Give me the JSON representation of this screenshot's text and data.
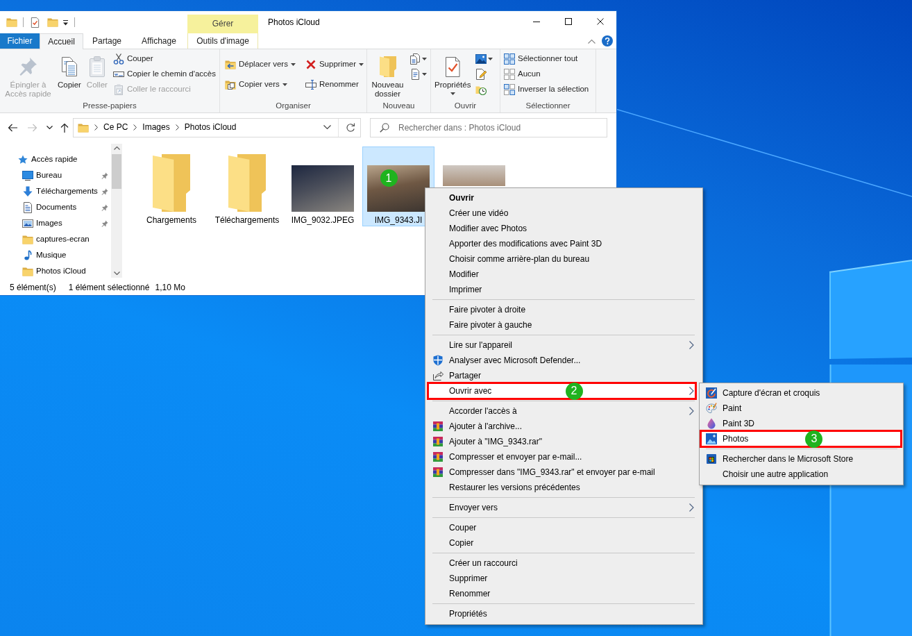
{
  "window": {
    "title": "Photos iCloud",
    "contextual_tab_group": "Gérer"
  },
  "tabs": [
    {
      "label": "Fichier",
      "kind": "file",
      "selected": false
    },
    {
      "label": "Accueil",
      "kind": "tab",
      "selected": true
    },
    {
      "label": "Partage",
      "kind": "tab",
      "selected": false
    },
    {
      "label": "Affichage",
      "kind": "tab",
      "selected": false
    },
    {
      "label": "Outils d'image",
      "kind": "contextual",
      "selected": false
    }
  ],
  "ribbon": {
    "groups": [
      {
        "label": "Presse-papiers",
        "buttons": [
          {
            "label": "Épingler à Accès rapide",
            "kind": "large",
            "disabled": true,
            "dropdown": false
          },
          {
            "label": "Copier",
            "kind": "large",
            "disabled": false,
            "dropdown": false
          },
          {
            "label": "Coller",
            "kind": "large",
            "disabled": true,
            "dropdown": false
          },
          {
            "label": "Couper",
            "kind": "small",
            "disabled": false,
            "dropdown": false
          },
          {
            "label": "Copier le chemin d'accès",
            "kind": "small",
            "disabled": false,
            "dropdown": false
          },
          {
            "label": "Coller le raccourci",
            "kind": "small",
            "disabled": true,
            "dropdown": false
          }
        ]
      },
      {
        "label": "Organiser",
        "buttons": [
          {
            "label": "Déplacer vers",
            "kind": "small",
            "disabled": false,
            "dropdown": true
          },
          {
            "label": "Copier vers",
            "kind": "small",
            "disabled": false,
            "dropdown": true
          },
          {
            "label": "Supprimer",
            "kind": "small",
            "disabled": false,
            "dropdown": true
          },
          {
            "label": "Renommer",
            "kind": "small",
            "disabled": false,
            "dropdown": false
          }
        ]
      },
      {
        "label": "Nouveau",
        "buttons": [
          {
            "label": "Nouveau dossier",
            "kind": "large",
            "disabled": false,
            "dropdown": false
          },
          {
            "kind": "icon",
            "disabled": false,
            "dropdown": true
          },
          {
            "kind": "icon",
            "disabled": false,
            "dropdown": true
          }
        ]
      },
      {
        "label": "Ouvrir",
        "buttons": [
          {
            "label": "Propriétés",
            "kind": "large",
            "disabled": false,
            "dropdown": true
          },
          {
            "kind": "icon",
            "disabled": false,
            "dropdown": true
          },
          {
            "kind": "icon",
            "disabled": false,
            "dropdown": false
          },
          {
            "kind": "icon",
            "disabled": false,
            "dropdown": false
          }
        ]
      },
      {
        "label": "Sélectionner",
        "buttons": [
          {
            "label": "Sélectionner tout",
            "kind": "small",
            "disabled": false,
            "dropdown": false
          },
          {
            "label": "Aucun",
            "kind": "small",
            "disabled": false,
            "dropdown": false
          },
          {
            "label": "Inverser la sélection",
            "kind": "small",
            "disabled": false,
            "dropdown": false
          }
        ]
      }
    ]
  },
  "navigation_buttons": [
    {
      "kind": "back",
      "disabled": false
    },
    {
      "kind": "forward",
      "disabled": true
    },
    {
      "kind": "recent",
      "disabled": false
    },
    {
      "kind": "up",
      "disabled": false
    }
  ],
  "address": {
    "path": [
      "Ce PC",
      "Images",
      "Photos iCloud"
    ]
  },
  "search": {
    "placeholder": "Rechercher dans : Photos iCloud"
  },
  "navigation": [
    {
      "label": "Accès rapide",
      "kind": "quick_access",
      "children": [
        {
          "label": "Bureau",
          "kind": "desktop",
          "pinned": true
        },
        {
          "label": "Téléchargements",
          "kind": "downloads",
          "pinned": true
        },
        {
          "label": "Documents",
          "kind": "documents",
          "pinned": true
        },
        {
          "label": "Images",
          "kind": "pictures",
          "pinned": true
        },
        {
          "label": "captures-ecran",
          "kind": "folder",
          "pinned": false
        },
        {
          "label": "Musique",
          "kind": "music",
          "pinned": false
        },
        {
          "label": "Photos iCloud",
          "kind": "folder",
          "pinned": false
        }
      ]
    }
  ],
  "files": [
    {
      "name": "Chargements",
      "kind": "folder",
      "selected": false
    },
    {
      "name": "Téléchargements",
      "kind": "folder",
      "selected": false
    },
    {
      "name": "IMG_9032.JPEG",
      "kind": "photo",
      "selected": false
    },
    {
      "name": "IMG_9343.JI",
      "kind": "photo",
      "selected": true,
      "marker": "1"
    },
    {
      "kind": "photo",
      "selected": false
    }
  ],
  "status_bar": {
    "count": "5 élément(s)",
    "selection": "1 élément sélectionné",
    "size": "1,10 Mo"
  },
  "context_menu": {
    "items": [
      {
        "label": "Ouvrir",
        "kind": "default",
        "highlighted": false
      },
      {
        "label": "Créer une vidéo",
        "kind": "plain",
        "highlighted": false
      },
      {
        "label": "Modifier avec Photos",
        "kind": "plain",
        "highlighted": false
      },
      {
        "label": "Apporter des modifications avec Paint 3D",
        "kind": "plain",
        "highlighted": false
      },
      {
        "label": "Choisir comme arrière-plan du bureau",
        "kind": "plain",
        "highlighted": false
      },
      {
        "label": "Modifier",
        "kind": "plain",
        "highlighted": false
      },
      {
        "label": "Imprimer",
        "kind": "plain",
        "highlighted": false
      },
      {
        "kind": "separator"
      },
      {
        "label": "Faire pivoter à droite",
        "kind": "plain",
        "highlighted": false
      },
      {
        "label": "Faire pivoter à gauche",
        "kind": "plain",
        "highlighted": false
      },
      {
        "kind": "separator"
      },
      {
        "label": "Lire sur l'appareil",
        "kind": "submenu",
        "highlighted": false
      },
      {
        "label": "Analyser avec Microsoft Defender...",
        "kind": "scan",
        "highlighted": false
      },
      {
        "label": "Partager",
        "kind": "share",
        "highlighted": false
      },
      {
        "label": "Ouvrir avec",
        "kind": "submenu",
        "highlighted": true,
        "marker": "2"
      },
      {
        "kind": "separator"
      },
      {
        "label": "Accorder l'accès à",
        "kind": "submenu",
        "highlighted": false
      },
      {
        "label": "Ajouter à l'archive...",
        "kind": "archive",
        "highlighted": false
      },
      {
        "label": "Ajouter à \"IMG_9343.rar\"",
        "kind": "archive",
        "highlighted": false
      },
      {
        "label": "Compresser et envoyer par e-mail...",
        "kind": "archive",
        "highlighted": false
      },
      {
        "label": "Compresser dans \"IMG_9343.rar\" et envoyer par e-mail",
        "kind": "archive",
        "highlighted": false
      },
      {
        "label": "Restaurer les versions précédentes",
        "kind": "plain",
        "highlighted": false
      },
      {
        "kind": "separator"
      },
      {
        "label": "Envoyer vers",
        "kind": "submenu",
        "highlighted": false
      },
      {
        "kind": "separator"
      },
      {
        "label": "Couper",
        "kind": "plain",
        "highlighted": false
      },
      {
        "label": "Copier",
        "kind": "plain",
        "highlighted": false
      },
      {
        "kind": "separator"
      },
      {
        "label": "Créer un raccourci",
        "kind": "plain",
        "highlighted": false
      },
      {
        "label": "Supprimer",
        "kind": "plain",
        "highlighted": false
      },
      {
        "label": "Renommer",
        "kind": "plain",
        "highlighted": false
      },
      {
        "kind": "separator"
      },
      {
        "label": "Propriétés",
        "kind": "plain",
        "highlighted": false
      }
    ]
  },
  "submenu": {
    "items": [
      {
        "label": "Capture d'écran et croquis",
        "kind": "snipping",
        "highlighted": false
      },
      {
        "label": "Paint",
        "kind": "paint",
        "highlighted": false
      },
      {
        "label": "Paint 3D",
        "kind": "paint3d",
        "highlighted": false
      },
      {
        "label": "Photos",
        "kind": "photos",
        "highlighted": true,
        "marker": "3"
      },
      {
        "kind": "separator"
      },
      {
        "label": "Rechercher dans le Microsoft Store",
        "kind": "store",
        "highlighted": false
      },
      {
        "label": "Choisir une autre application",
        "kind": "plain",
        "highlighted": false
      }
    ]
  }
}
